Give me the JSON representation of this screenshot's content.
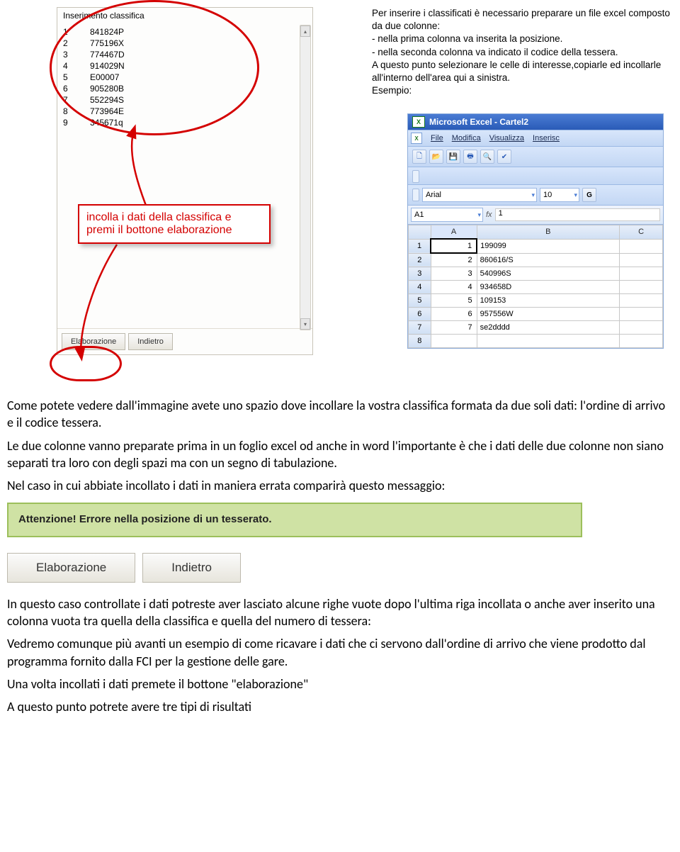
{
  "app": {
    "title": "Inserimento classifica",
    "rows": [
      {
        "pos": "1",
        "code": "841824P"
      },
      {
        "pos": "2",
        "code": "775196X"
      },
      {
        "pos": "3",
        "code": "774467D"
      },
      {
        "pos": "4",
        "code": "914029N"
      },
      {
        "pos": "5",
        "code": "E00007"
      },
      {
        "pos": "6",
        "code": "905280B"
      },
      {
        "pos": "7",
        "code": "552294S"
      },
      {
        "pos": "8",
        "code": "773964E"
      },
      {
        "pos": "9",
        "code": "345671q"
      }
    ],
    "buttons": {
      "elab": "Elaborazione",
      "back": "Indietro"
    }
  },
  "callout": "incolla i dati della classifica e premi il bottone elaborazione",
  "instructions": {
    "line1": "Per inserire i classificati è necessario preparare un file excel composto da due colonne:",
    "line2": "- nella prima colonna va inserita la posizione.",
    "line3": "- nella seconda colonna va indicato il codice della tessera.",
    "line4": "A questo punto selezionare le celle di interesse,copiarle ed incollarle all'interno dell'area qui a sinistra.",
    "line5": "Esempio:"
  },
  "excel": {
    "title": "Microsoft Excel - Cartel2",
    "menu": [
      "File",
      "Modifica",
      "Visualizza",
      "Inserisc"
    ],
    "font": "Arial",
    "fontsize": "10",
    "bold": "G",
    "namebox": "A1",
    "formula": "1",
    "cols": [
      "A",
      "B",
      "C"
    ],
    "rows": [
      {
        "n": "1",
        "a": "1",
        "b": "199099"
      },
      {
        "n": "2",
        "a": "2",
        "b": "860616/S"
      },
      {
        "n": "3",
        "a": "3",
        "b": "540996S"
      },
      {
        "n": "4",
        "a": "4",
        "b": "934658D"
      },
      {
        "n": "5",
        "a": "5",
        "b": "109153"
      },
      {
        "n": "6",
        "a": "6",
        "b": "957556W"
      },
      {
        "n": "7",
        "a": "7",
        "b": "se2dddd"
      },
      {
        "n": "8",
        "a": "",
        "b": ""
      }
    ]
  },
  "body": {
    "p1": "Come potete vedere dall'immagine avete uno spazio dove incollare la vostra classifica formata da due soli dati: l'ordine di arrivo e il codice tessera.",
    "p2": "Le due colonne vanno preparate prima in un foglio excel od anche in word l'importante è che i dati delle due colonne non siano separati tra loro con degli spazi ma con un segno di tabulazione.",
    "p3": "Nel caso in cui abbiate incollato i dati in maniera errata comparirà questo messaggio:",
    "error": "Attenzione! Errore nella posizione di un tesserato.",
    "errbtn1": "Elaborazione",
    "errbtn2": "Indietro",
    "p4": "In questo caso controllate i dati potreste aver lasciato alcune righe vuote dopo l'ultima riga incollata o anche aver inserito una colonna vuota tra quella della classifica e quella del numero di tessera:",
    "p5": "Vedremo comunque più avanti un esempio di come ricavare i dati che ci servono dall'ordine di arrivo che viene prodotto dal programma fornito dalla FCI per la gestione delle gare.",
    "p6": "Una volta incollati i dati premete il bottone \"elaborazione\"",
    "p7": "A questo punto potrete avere tre tipi di risultati"
  }
}
